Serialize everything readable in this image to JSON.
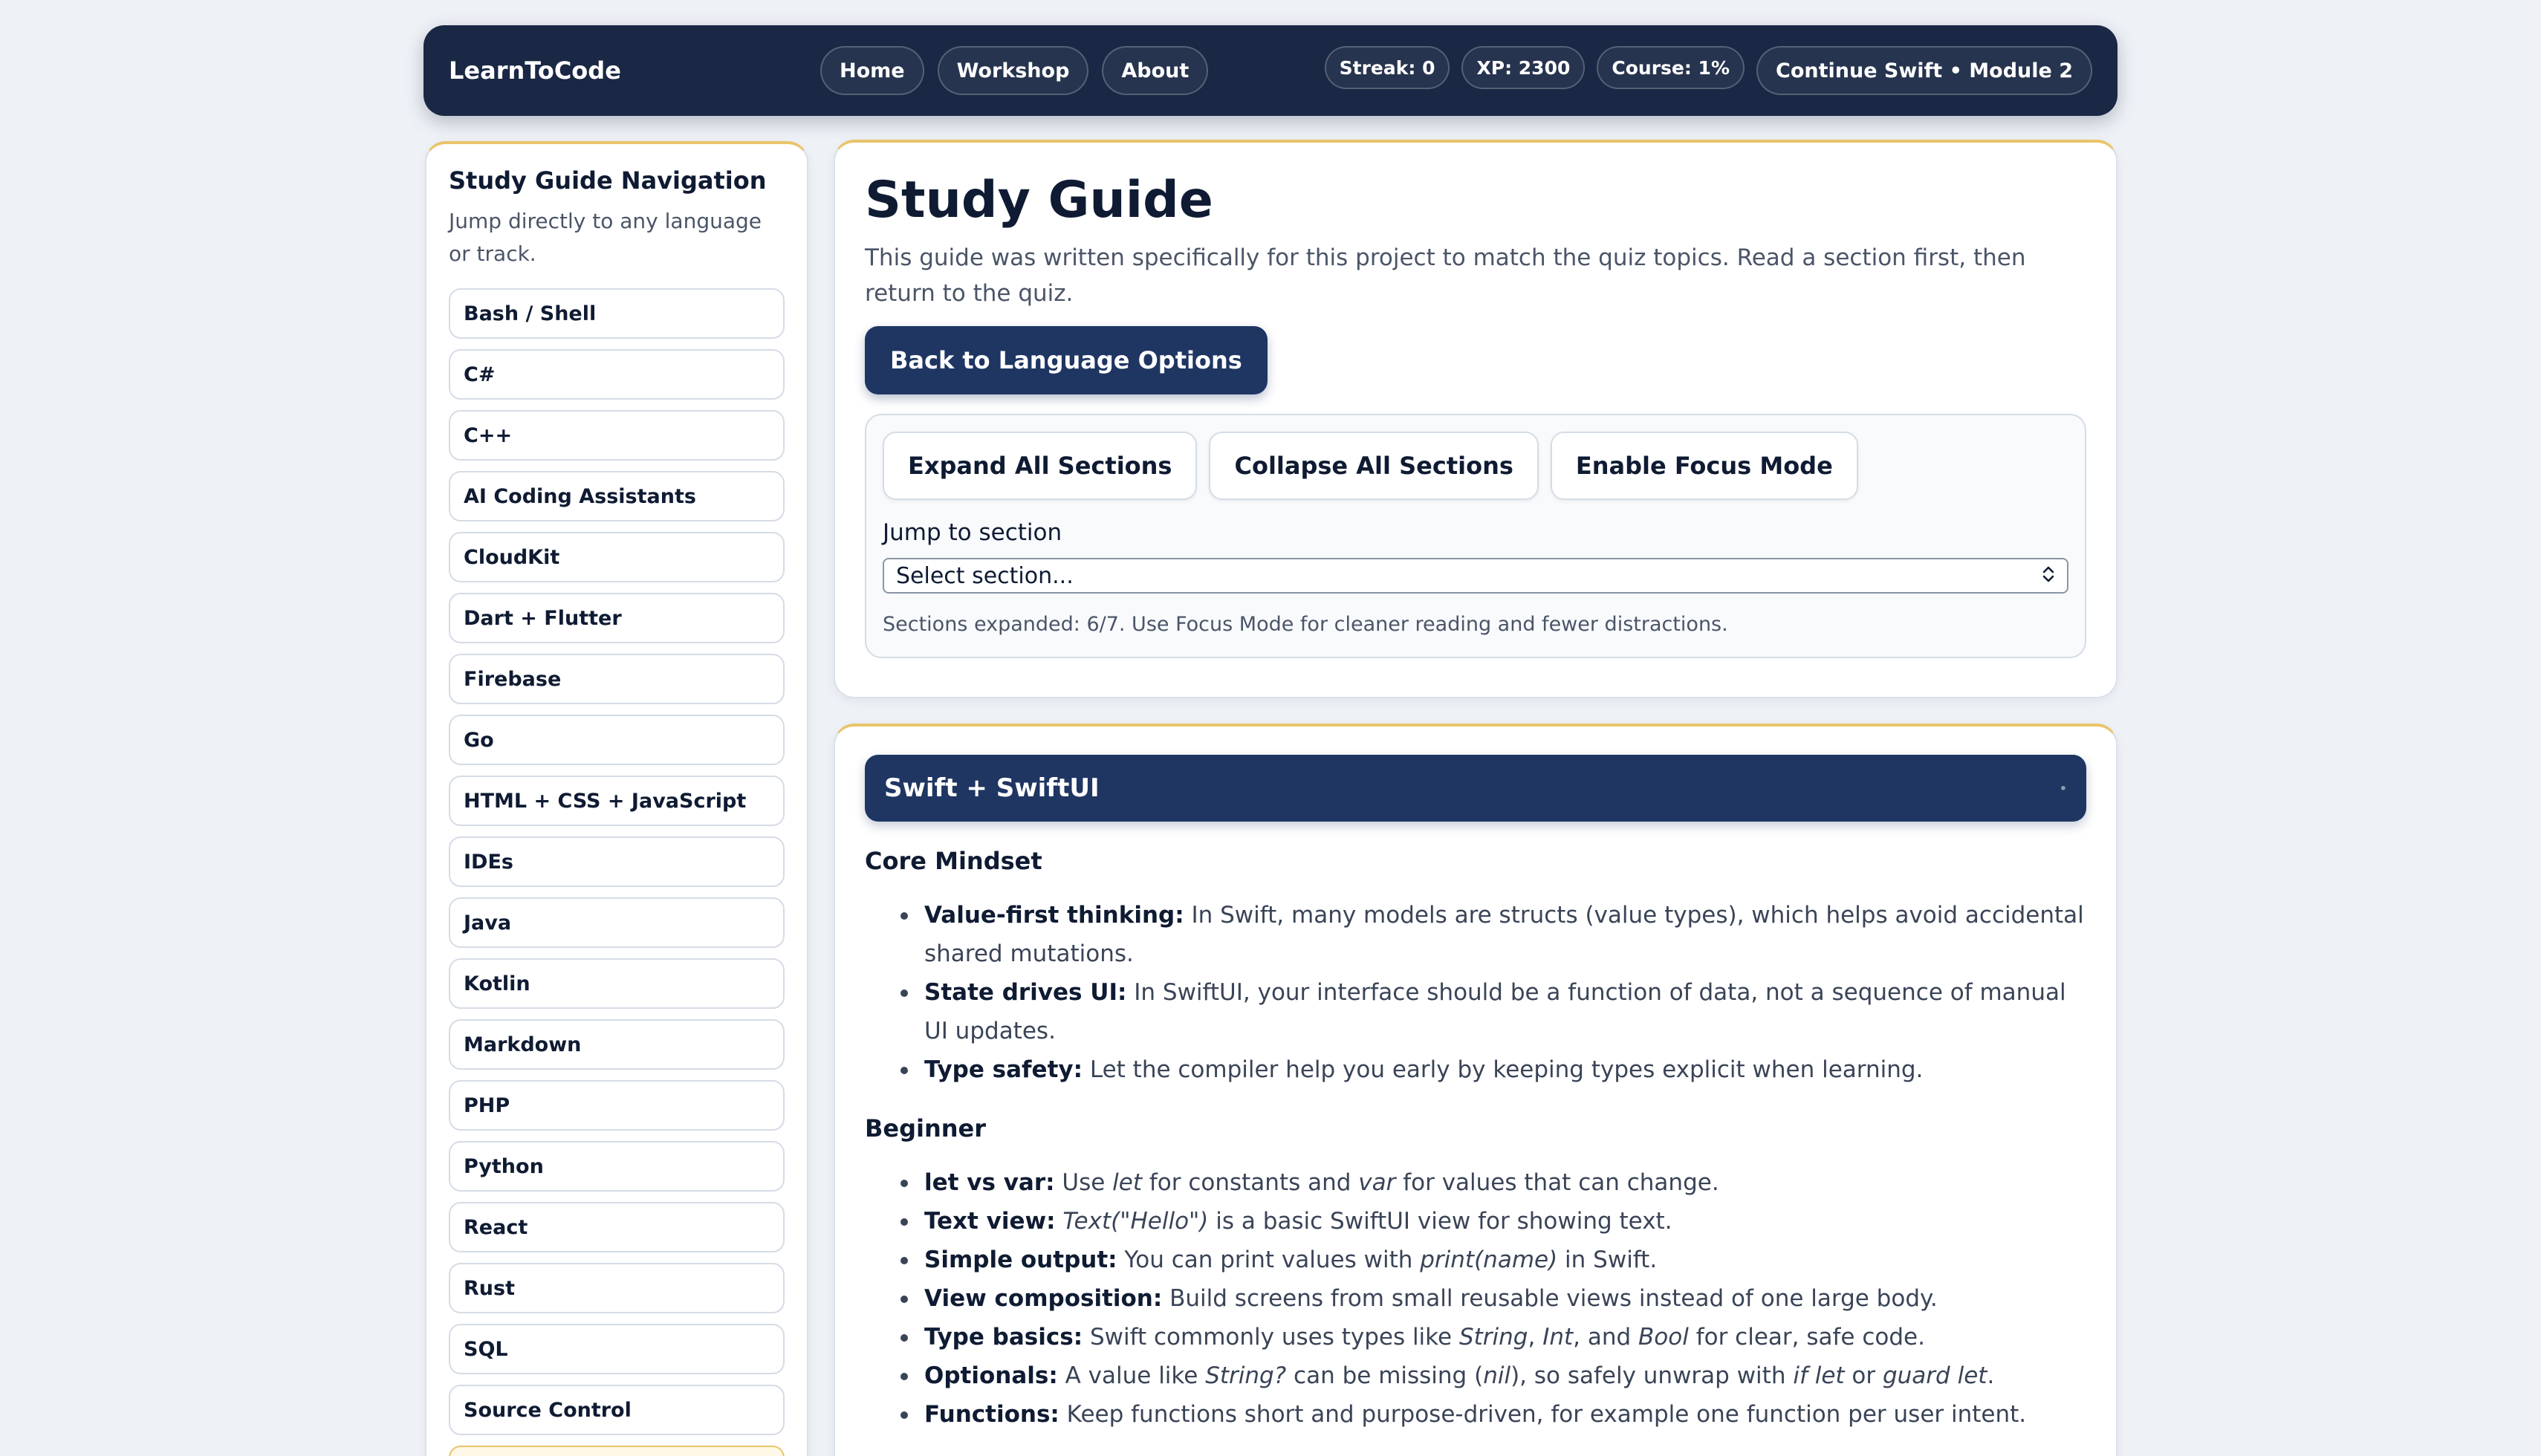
{
  "header": {
    "brand": "LearnToCode",
    "nav": [
      "Home",
      "Workshop",
      "About"
    ],
    "stats": [
      "Streak: 0",
      "XP: 2300",
      "Course: 1%"
    ],
    "continue_label": "Continue Swift • Module 2"
  },
  "sidebar": {
    "title": "Study Guide Navigation",
    "description": "Jump directly to any language or track.",
    "items": [
      "Bash / Shell",
      "C#",
      "C++",
      "AI Coding Assistants",
      "CloudKit",
      "Dart + Flutter",
      "Firebase",
      "Go",
      "HTML + CSS + JavaScript",
      "IDEs",
      "Java",
      "Kotlin",
      "Markdown",
      "PHP",
      "Python",
      "React",
      "Rust",
      "SQL",
      "Source Control",
      ""
    ]
  },
  "guide": {
    "title": "Study Guide",
    "intro": "This guide was written specifically for this project to match the quiz topics. Read a section first, then return to the quiz.",
    "back_label": "Back to Language Options",
    "expand_label": "Expand All Sections",
    "collapse_label": "Collapse All Sections",
    "focus_label": "Enable Focus Mode",
    "jump_label": "Jump to section",
    "select_value": "Select section...",
    "status": "Sections expanded: 6/7. Use Focus Mode for cleaner reading and fewer distractions."
  },
  "section": {
    "title": "Swift + SwiftUI",
    "toggle_icon": "•",
    "core_heading": "Core Mindset",
    "core_items": [
      {
        "term": "Value-first thinking:",
        "text": " In Swift, many models are structs (value types), which helps avoid accidental shared mutations."
      },
      {
        "term": "State drives UI:",
        "text": " In SwiftUI, your interface should be a function of data, not a sequence of manual UI updates."
      },
      {
        "term": "Type safety:",
        "text": " Let the compiler help you early by keeping types explicit when learning."
      }
    ],
    "beginner_heading": "Beginner",
    "beginner_items": [
      {
        "term": "let vs var:",
        "parts": [
          " Use ",
          {
            "i": "let"
          },
          " for constants and ",
          {
            "i": "var"
          },
          " for values that can change."
        ]
      },
      {
        "term": "Text view:",
        "parts": [
          " ",
          {
            "i": "Text(\"Hello\")"
          },
          " is a basic SwiftUI view for showing text."
        ]
      },
      {
        "term": "Simple output:",
        "parts": [
          " You can print values with ",
          {
            "i": "print(name)"
          },
          " in Swift."
        ]
      },
      {
        "term": "View composition:",
        "parts": [
          " Build screens from small reusable views instead of one large body."
        ]
      },
      {
        "term": "Type basics:",
        "parts": [
          " Swift commonly uses types like ",
          {
            "i": "String"
          },
          ", ",
          {
            "i": "Int"
          },
          ", and ",
          {
            "i": "Bool"
          },
          " for clear, safe code."
        ]
      },
      {
        "term": "Optionals:",
        "parts": [
          " A value like ",
          {
            "i": "String?"
          },
          " can be missing (",
          {
            "i": "nil"
          },
          "), so safely unwrap with ",
          {
            "i": "if let"
          },
          " or ",
          {
            "i": "guard let"
          },
          "."
        ]
      },
      {
        "term": "Functions:",
        "parts": [
          " Keep functions short and purpose-driven, for example one function per user intent."
        ]
      }
    ]
  },
  "colors": {
    "navy": "#1a2845",
    "button_navy": "#1f3663",
    "accent_gold": "#e9c46a",
    "background": "#eef1f6"
  }
}
